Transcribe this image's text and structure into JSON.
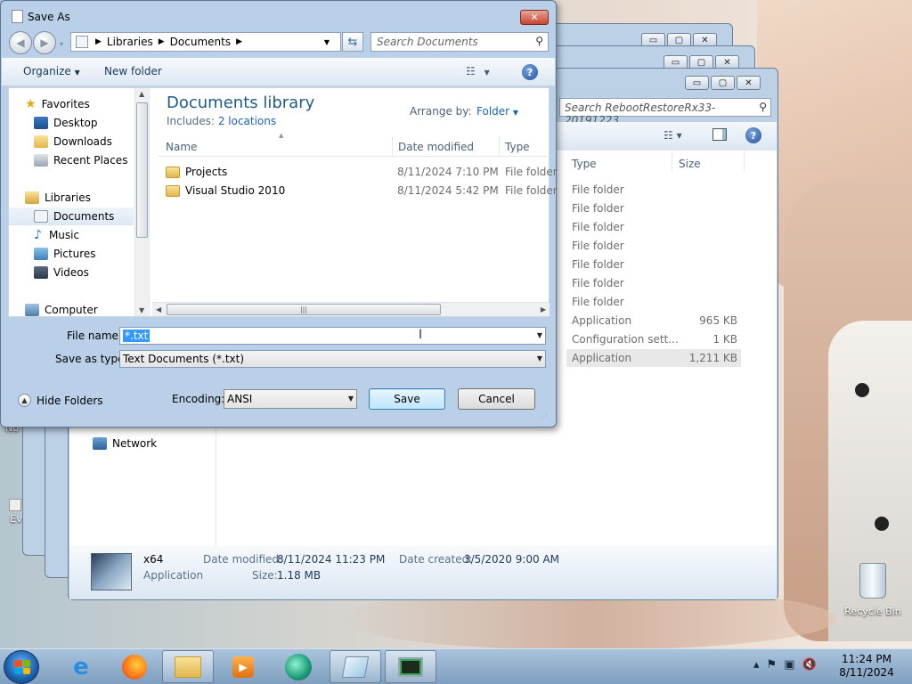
{
  "wallpaper": {
    "accent": "#e6d6c8"
  },
  "explorer": {
    "search_placeholder": "Search RebootRestoreRx33-20191223",
    "columns": {
      "type": "Type",
      "size": "Size"
    },
    "network_label": "Network",
    "rows": [
      {
        "type": "File folder",
        "size": ""
      },
      {
        "type": "File folder",
        "size": ""
      },
      {
        "type": "File folder",
        "size": ""
      },
      {
        "type": "File folder",
        "size": ""
      },
      {
        "type": "File folder",
        "size": ""
      },
      {
        "type": "File folder",
        "size": ""
      },
      {
        "type": "File folder",
        "size": ""
      },
      {
        "type": "Application",
        "size": "965 KB"
      },
      {
        "type": "Configuration sett...",
        "size": "1 KB"
      },
      {
        "type": "Application",
        "size": "1,211 KB"
      }
    ],
    "details": {
      "name": "x64",
      "kind": "Application",
      "modified_label": "Date modified:",
      "modified_value": "8/11/2024 11:23 PM",
      "created_label": "Date created:",
      "created_value": "3/5/2020 9:00 AM",
      "size_label": "Size:",
      "size_value": "1.18 MB"
    }
  },
  "dialog": {
    "title": "Save As",
    "breadcrumb": [
      "Libraries",
      "Documents"
    ],
    "search_placeholder": "Search Documents",
    "toolbar": {
      "organize": "Organize",
      "new_folder": "New folder"
    },
    "nav": {
      "favorites": "Favorites",
      "desktop": "Desktop",
      "downloads": "Downloads",
      "recent": "Recent Places",
      "libraries": "Libraries",
      "documents": "Documents",
      "music": "Music",
      "pictures": "Pictures",
      "videos": "Videos",
      "computer": "Computer"
    },
    "library_title": "Documents library",
    "includes_label": "Includes:",
    "includes_link": "2 locations",
    "arrange_label": "Arrange by:",
    "arrange_value": "Folder",
    "columns": {
      "name": "Name",
      "date": "Date modified",
      "type": "Type"
    },
    "files": [
      {
        "name": "Projects",
        "date": "8/11/2024 7:10 PM",
        "type": "File folder"
      },
      {
        "name": "Visual Studio 2010",
        "date": "8/11/2024 5:42 PM",
        "type": "File folder"
      }
    ],
    "file_name_label": "File name:",
    "file_name_value": "*.txt",
    "save_type_label": "Save as type:",
    "save_type_value": "Text Documents (*.txt)",
    "hide_folders": "Hide Folders",
    "encoding_label": "Encoding:",
    "encoding_value": "ANSI",
    "save": "Save",
    "cancel": "Cancel"
  },
  "desktop": {
    "recycle_bin": "Recycle Bin",
    "partial_a": "No",
    "partial_b": "Ev"
  },
  "taskbar": {
    "time": "11:24 PM",
    "date": "8/11/2024"
  }
}
